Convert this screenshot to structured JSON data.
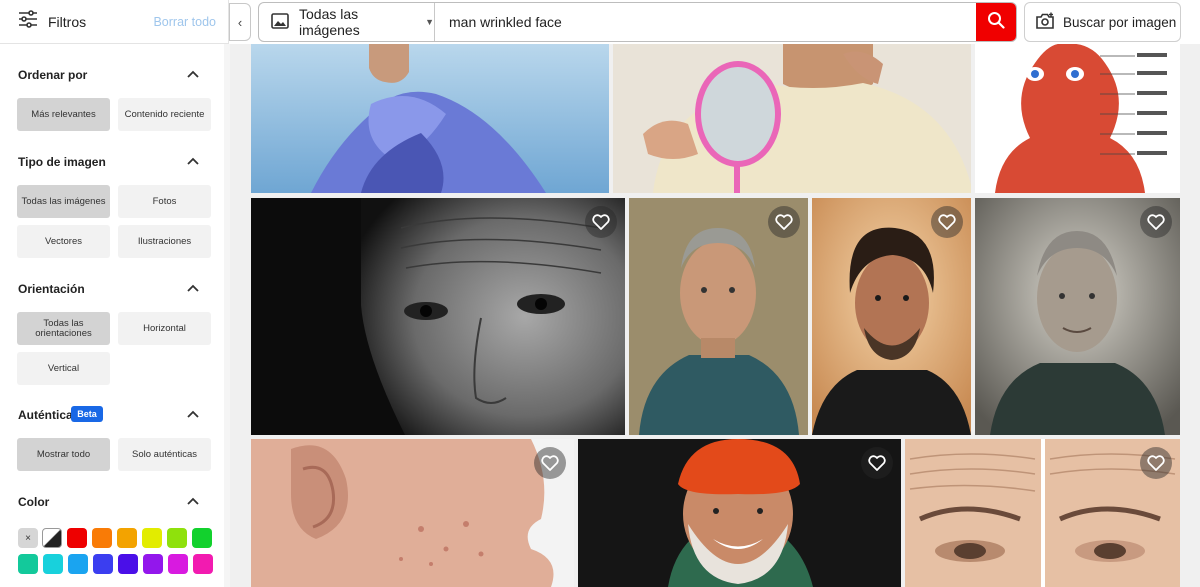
{
  "filters_header": {
    "label": "Filtros",
    "clear_label": "Borrar todo",
    "collapse_glyph": "‹"
  },
  "search": {
    "type_label": "Todas las imágenes",
    "query": "man wrinkled face",
    "image_search_label": "Buscar por imagen"
  },
  "sort": {
    "title": "Ordenar por",
    "options": [
      "Más relevantes",
      "Contenido reciente"
    ],
    "selected": "Más relevantes"
  },
  "image_type": {
    "title": "Tipo de imagen",
    "options": [
      "Todas las imágenes",
      "Fotos",
      "Vectores",
      "Ilustraciones"
    ],
    "selected": "Todas las imágenes"
  },
  "orientation": {
    "title": "Orientación",
    "options": [
      "Todas las orientaciones",
      "Horizontal",
      "Vertical"
    ],
    "selected": "Todas las orientaciones"
  },
  "authentic": {
    "title": "Auténtica",
    "badge": "Beta",
    "options": [
      "Mostrar todo",
      "Solo auténticas"
    ],
    "selected": "Mostrar todo"
  },
  "color": {
    "title": "Color",
    "clear_glyph": "×",
    "swatches_row1": [
      "#ee0000",
      "#f97b06",
      "#f3a300",
      "#e2ec00",
      "#8fe10c",
      "#12d12d"
    ],
    "swatches_row2": [
      "#13c99b",
      "#18d1dc",
      "#1aa4f0",
      "#3b3ef0",
      "#4a0fe8",
      "#9317ec",
      "#d81ae0",
      "#f21bb0"
    ]
  },
  "colors": {
    "accent": "#f00000",
    "selected_option": "#d3d3d3",
    "option": "#f2f2f2",
    "beta": "#1968e6",
    "clear_link": "#9fc6ec"
  },
  "icons": [
    "sliders-icon",
    "image-icon",
    "search-icon",
    "camera-search-icon",
    "chevron-up-icon",
    "heart-icon"
  ]
}
